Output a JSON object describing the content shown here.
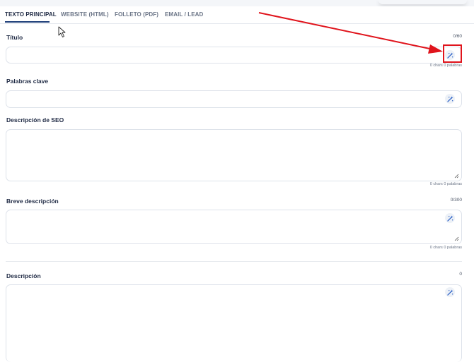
{
  "tabs": [
    {
      "label": "TEXTO PRINCIPAL",
      "active": true
    },
    {
      "label": "WEBSITE (HTML)",
      "active": false
    },
    {
      "label": "FOLLETO (PDF)",
      "active": false
    },
    {
      "label": "EMAIL / LEAD",
      "active": false
    }
  ],
  "fields": {
    "titulo": {
      "label": "Título",
      "limit": "0/60",
      "counter": "0 chars 0 palabras",
      "value": ""
    },
    "palabras_clave": {
      "label": "Palabras clave",
      "value": ""
    },
    "seo": {
      "label": "Descripción de SEO",
      "counter": "0 chars 0 palabras",
      "value": ""
    },
    "breve": {
      "label": "Breve descripción",
      "limit": "0/300",
      "counter": "0 chars 0 palabras",
      "value": ""
    },
    "descripcion": {
      "label": "Descripción",
      "limit": "0",
      "value": ""
    }
  },
  "icons": {
    "ai_assist": "magic-wand-icon",
    "resize": "resize-grip-icon",
    "cursor": "mouse-pointer-icon"
  },
  "colors": {
    "accent": "#1f3f7a",
    "annotation": "#e0141c",
    "icon": "#2f63c7"
  }
}
